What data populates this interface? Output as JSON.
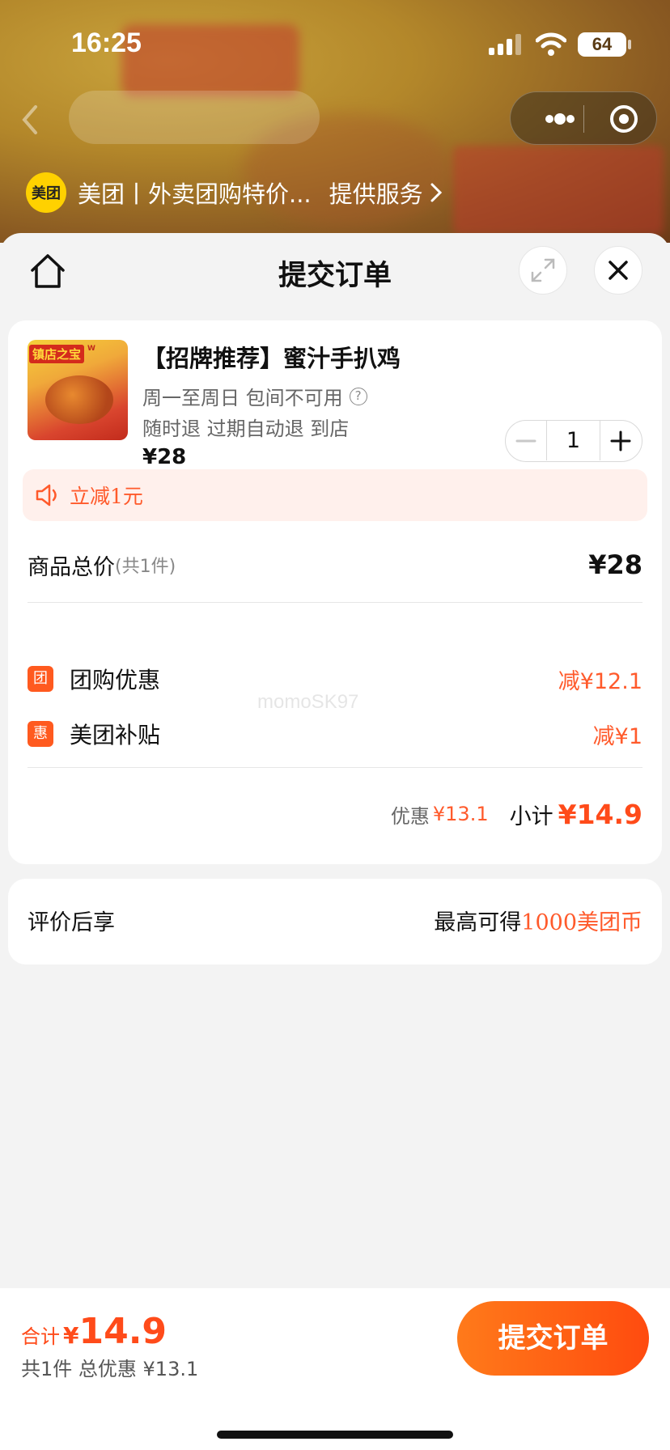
{
  "status_bar": {
    "time": "16:25",
    "battery": "64"
  },
  "provider": {
    "logo_text": "美团",
    "name": "美团丨外卖团购特价...",
    "service": "提供服务"
  },
  "sheet": {
    "title": "提交订单"
  },
  "product": {
    "name": "【招牌推荐】蜜汁手扒鸡",
    "line1": "周一至周日 包间不可用",
    "line2": "随时退 过期自动退 到店",
    "price": "¥28",
    "quantity": "1",
    "image_tag": "镇店之宝",
    "image_brand": "W"
  },
  "promo": {
    "text": "立减1元"
  },
  "summary": {
    "total_label": "商品总价",
    "total_count": "(共1件)",
    "total_value": "¥28",
    "discounts": [
      {
        "badge": "团",
        "label": "团购优惠",
        "value": "减¥12.1"
      },
      {
        "badge": "惠",
        "label": "美团补贴",
        "value": "减¥1"
      }
    ],
    "saving_label": "优惠",
    "saving_value": "¥13.1",
    "subtotal_label": "小计",
    "subtotal_value": "¥14.9"
  },
  "watermark": "momoSK97",
  "review": {
    "label": "评价后享",
    "prefix": "最高可得",
    "coins": "1000美团币"
  },
  "bottom": {
    "total_label": "合计",
    "currency": "¥",
    "total_value": "14.9",
    "count_text": "共1件 总优惠 ¥13.1",
    "submit_label": "提交订单"
  },
  "colors": {
    "accent": "#ff5a2b",
    "brand_yellow": "#ffd100",
    "button_start": "#ff7a1a",
    "button_end": "#ff4b0f"
  }
}
